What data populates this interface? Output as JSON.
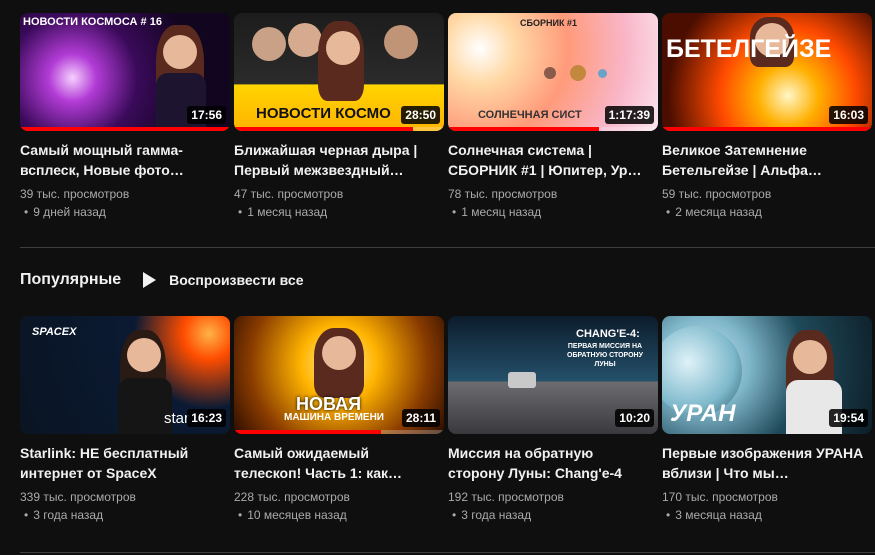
{
  "colors": {
    "background": "#0f0f0f",
    "progress": "#ff0000",
    "meta_text": "#aaaaaa"
  },
  "row1": [
    {
      "thumb_text": "НОВОСТИ КОСМОСА # 16",
      "duration": "17:56",
      "progress": 1.0,
      "title": "Самый мощный гамма-всплеск, Новые фото…",
      "views": "39 тыс. просмотров",
      "ago": "9 дней назад"
    },
    {
      "thumb_text": "НОВОСТИ КОСМО",
      "duration": "28:50",
      "progress": 0.85,
      "title": "Ближайшая черная дыра | Первый межзвездный…",
      "views": "47 тыс. просмотров",
      "ago": "1 месяц назад"
    },
    {
      "thumb_text": "СБОРНИК #1",
      "thumb_text_2": "СОЛНЕЧНАЯ СИСТ",
      "duration": "1:17:39",
      "progress": 0.72,
      "title": "Солнечная система | СБОРНИК #1 | Юпитер, Ур…",
      "views": "78 тыс. просмотров",
      "ago": "1 месяц назад"
    },
    {
      "thumb_text": "БЕТЕЛГЕЙЗЕ",
      "duration": "16:03",
      "progress": 1.0,
      "title": "Великое Затемнение Бетельгейзе | Альфа…",
      "views": "59 тыс. просмотров",
      "ago": "2 месяца назад"
    }
  ],
  "section": {
    "title": "Популярные",
    "play_all": "Воспроизвести все"
  },
  "row2": [
    {
      "thumb_text": "SPACEX",
      "thumb_text_2": "star",
      "duration": "16:23",
      "progress": 0,
      "title": "Starlink: НЕ бесплатный интернет от SpaceX",
      "views": "339 тыс. просмотров",
      "ago": "3 года назад"
    },
    {
      "thumb_text": "НОВАЯ",
      "thumb_text_2": "МАШИНА ВРЕМЕНИ",
      "duration": "28:11",
      "progress": 0.7,
      "title": "Самый ожидаемый телескоп! Часть 1: как…",
      "views": "228 тыс. просмотров",
      "ago": "10 месяцев назад"
    },
    {
      "thumb_text": "CHANG'E-4:",
      "thumb_text_2": "ПЕРВАЯ МИССИЯ НА ОБРАТНУЮ СТОРОНУ ЛУНЫ",
      "duration": "10:20",
      "progress": 0,
      "title": "Миссия на обратную сторону Луны: Chang'e-4",
      "views": "192 тыс. просмотров",
      "ago": "3 года назад"
    },
    {
      "thumb_text": "УРАН",
      "duration": "19:54",
      "progress": 0,
      "title": "Первые изображения УРАНА вблизи | Что мы…",
      "views": "170 тыс. просмотров",
      "ago": "3 месяца назад"
    }
  ]
}
